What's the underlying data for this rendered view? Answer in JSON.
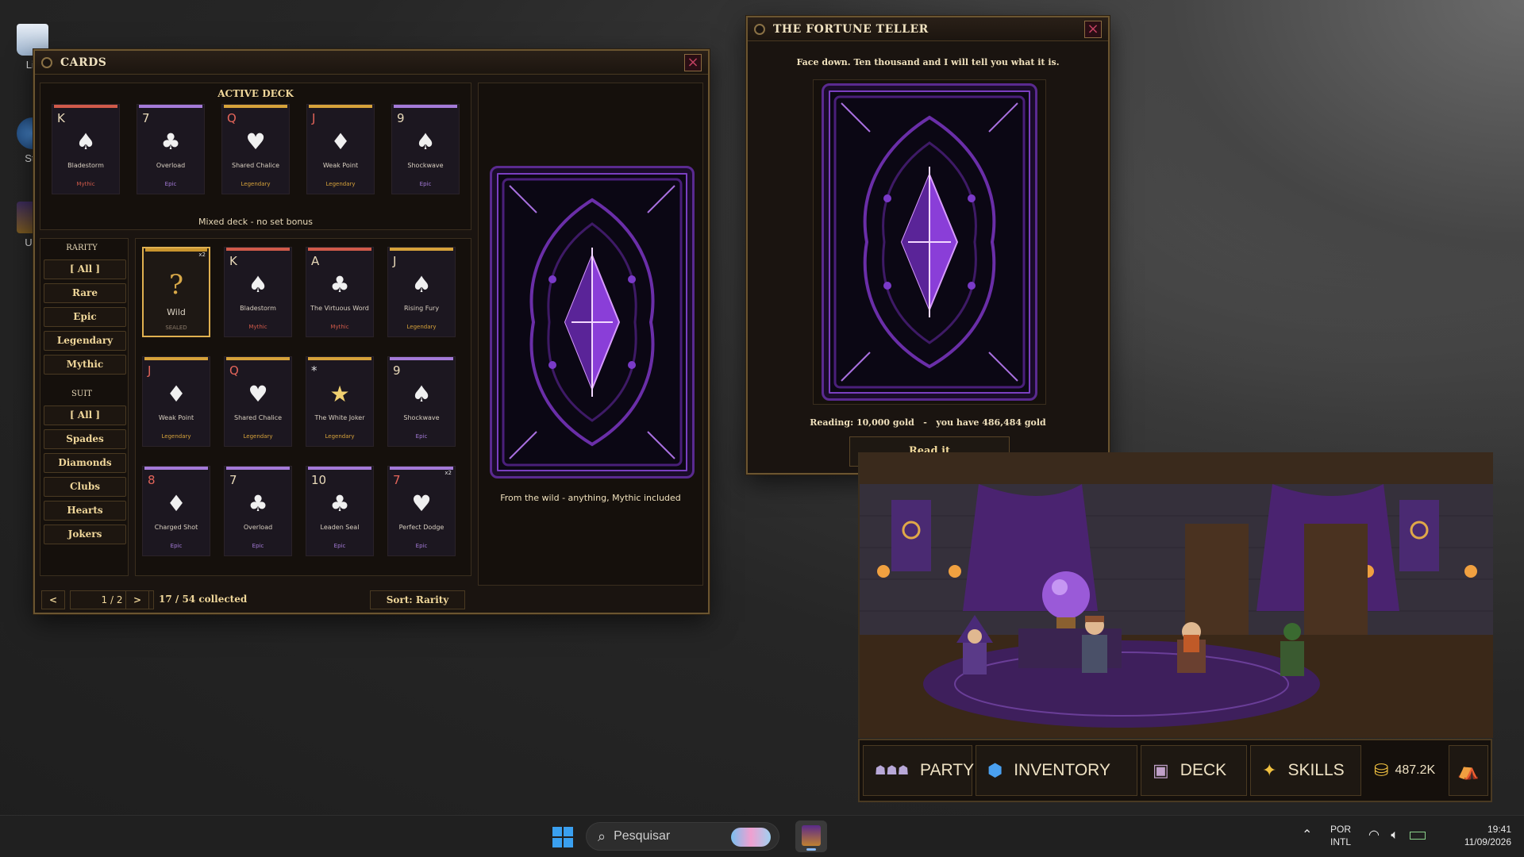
{
  "desktop": {
    "icons": [
      {
        "label": "Lix",
        "icon": "recycle-bin-icon"
      },
      {
        "label": "Ste",
        "icon": "steam-icon"
      },
      {
        "label": "Uni",
        "icon": "game-shortcut-icon"
      }
    ]
  },
  "cards_window": {
    "title": "CARDS",
    "active_deck": {
      "title": "ACTIVE DECK",
      "cards": [
        {
          "rank": "K",
          "suit": "♠",
          "name": "Bladestorm",
          "rarity": "Mythic",
          "color_class": "mythic",
          "red": false
        },
        {
          "rank": "7",
          "suit": "♣",
          "name": "Overload",
          "rarity": "Epic",
          "color_class": "epic",
          "red": false
        },
        {
          "rank": "Q",
          "suit": "♥",
          "name": "Shared Chalice",
          "rarity": "Legendary",
          "color_class": "legendary",
          "red": true
        },
        {
          "rank": "J",
          "suit": "♦",
          "name": "Weak Point",
          "rarity": "Legendary",
          "color_class": "legendary",
          "red": true
        },
        {
          "rank": "9",
          "suit": "♠",
          "name": "Shockwave",
          "rarity": "Epic",
          "color_class": "epic",
          "red": false
        }
      ],
      "bonus_text": "Mixed deck - no set bonus"
    },
    "filters": {
      "rarity_label": "RARITY",
      "rarity": [
        "[ All ]",
        "Rare",
        "Epic",
        "Legendary",
        "Mythic"
      ],
      "suit_label": "SUIT",
      "suit": [
        "[ All ]",
        "Spades",
        "Diamonds",
        "Clubs",
        "Hearts",
        "Jokers"
      ]
    },
    "collection": [
      {
        "rank": "?",
        "suit": "",
        "name": "Wild",
        "rarity": "SEALED",
        "color_class": "wild",
        "red": false,
        "mult": "x2",
        "wild": true
      },
      {
        "rank": "K",
        "suit": "♠",
        "name": "Bladestorm",
        "rarity": "Mythic",
        "color_class": "mythic",
        "red": false,
        "mult": ""
      },
      {
        "rank": "A",
        "suit": "♣",
        "name": "The Virtuous Word",
        "rarity": "Mythic",
        "color_class": "mythic",
        "red": false,
        "mult": ""
      },
      {
        "rank": "J",
        "suit": "♠",
        "name": "Rising Fury",
        "rarity": "Legendary",
        "color_class": "legendary",
        "red": false,
        "mult": ""
      },
      {
        "rank": "J",
        "suit": "♦",
        "name": "Weak Point",
        "rarity": "Legendary",
        "color_class": "legendary",
        "red": true,
        "mult": ""
      },
      {
        "rank": "Q",
        "suit": "♥",
        "name": "Shared Chalice",
        "rarity": "Legendary",
        "color_class": "legendary",
        "red": true,
        "mult": ""
      },
      {
        "rank": "*",
        "suit": "★",
        "name": "The White Joker",
        "rarity": "Legendary",
        "color_class": "legendary",
        "red": false,
        "mult": "",
        "joker": true
      },
      {
        "rank": "9",
        "suit": "♠",
        "name": "Shockwave",
        "rarity": "Epic",
        "color_class": "epic",
        "red": false,
        "mult": ""
      },
      {
        "rank": "8",
        "suit": "♦",
        "name": "Charged Shot",
        "rarity": "Epic",
        "color_class": "epic",
        "red": true,
        "mult": ""
      },
      {
        "rank": "7",
        "suit": "♣",
        "name": "Overload",
        "rarity": "Epic",
        "color_class": "epic",
        "red": false,
        "mult": ""
      },
      {
        "rank": "10",
        "suit": "♣",
        "name": "Leaden Seal",
        "rarity": "Epic",
        "color_class": "epic",
        "red": false,
        "mult": ""
      },
      {
        "rank": "7",
        "suit": "♥",
        "name": "Perfect Dodge",
        "rarity": "Epic",
        "color_class": "epic",
        "red": true,
        "mult": "x2"
      }
    ],
    "preview_caption": "From the wild - anything, Mythic included",
    "footer": {
      "prev": "<",
      "page": "1 / 2",
      "next": ">",
      "collected": "17 / 54 collected",
      "sort": "Sort: Rarity"
    }
  },
  "fortune_window": {
    "title": "THE FORTUNE TELLER",
    "prompt": "Face down. Ten thousand and I will tell you what it is.",
    "reading_text": "Reading: 10,000 gold   -   you have 486,484 gold",
    "button": "Read it"
  },
  "game_nav": {
    "items": [
      {
        "label": "PARTY",
        "icon": "party-icon"
      },
      {
        "label": "INVENTORY",
        "icon": "inventory-gem-icon"
      },
      {
        "label": "DECK",
        "icon": "deck-icon"
      },
      {
        "label": "SKILLS",
        "icon": "skills-spark-icon"
      }
    ],
    "gold": "487.2K"
  },
  "taskbar": {
    "search_placeholder": "Pesquisar",
    "lang_1": "POR",
    "lang_2": "INTL",
    "time": "19:41",
    "date": "11/09/2026"
  }
}
